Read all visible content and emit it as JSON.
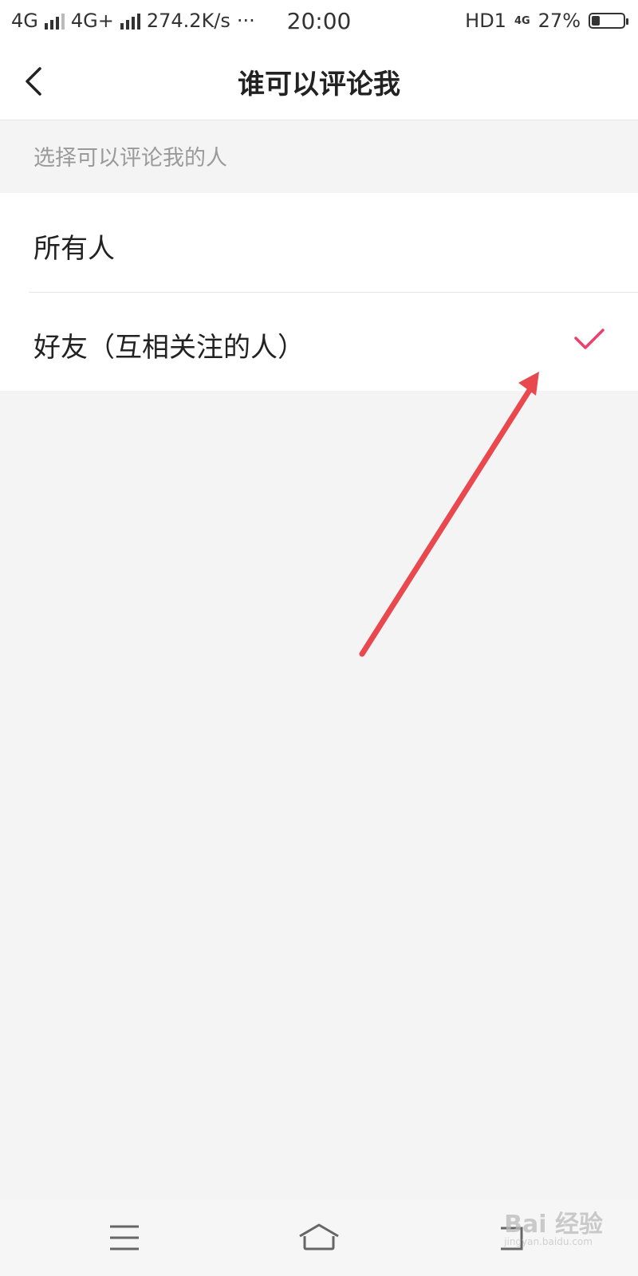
{
  "status_bar": {
    "network1": "4G",
    "network2": "4G+",
    "speed": "274.2K/s",
    "dots": "···",
    "time": "20:00",
    "hd": "HD1",
    "net_small": "4G",
    "battery": "27%",
    "battery_level": 0.27
  },
  "header": {
    "title": "谁可以评论我",
    "back_icon": "chevron-left-icon"
  },
  "section_label": "选择可以评论我的人",
  "options": [
    {
      "label": "所有人",
      "selected": false
    },
    {
      "label": "好友（互相关注的人）",
      "selected": true
    }
  ],
  "colors": {
    "accent": "#f03e6b",
    "annotation_arrow": "#e8484e",
    "background": "#f4f4f4"
  },
  "nav_bar": {
    "menu_icon": "menu-icon",
    "home_icon": "home-icon",
    "back_icon": "back-nav-icon"
  },
  "watermark": {
    "text": "Bai 经验",
    "url": "jingyan.baidu.com"
  }
}
